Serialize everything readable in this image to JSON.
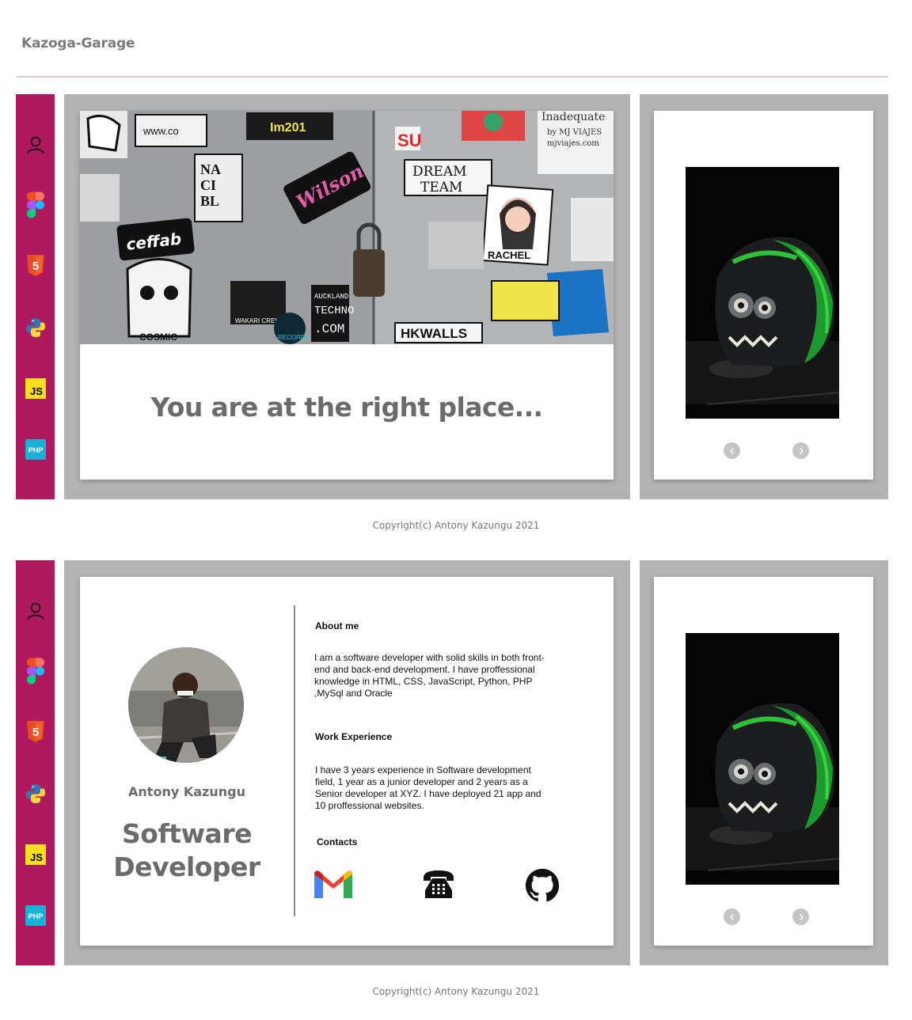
{
  "brand": {
    "title": "Kazoga-Garage"
  },
  "sidebar": {
    "items": [
      {
        "icon": "user-icon"
      },
      {
        "icon": "figma-icon"
      },
      {
        "icon": "html5-icon",
        "text": "5"
      },
      {
        "icon": "python-icon"
      },
      {
        "icon": "javascript-icon",
        "text": "JS"
      },
      {
        "icon": "php-icon",
        "text": "PHP"
      }
    ]
  },
  "hero": {
    "tagline": "You are at the right place...",
    "stickers": [
      "www.co",
      "Im201",
      "Inadequate",
      "by MJ VIAJES",
      "mjviajes.com",
      "SU",
      "NA",
      "CI",
      "BL",
      "DREAM",
      "TEAM",
      "Wilson",
      "ceffab",
      "RACHEL",
      "AUCKLAND",
      "TECHNO",
      ".COM",
      "HKWALLS",
      "COSMIC",
      "WAKARI CREW",
      "RECORDS"
    ]
  },
  "profile": {
    "name": "Antony Kazungu",
    "role_line1": "Software",
    "role_line2": "Developer",
    "about_title": "About me",
    "about_text": "I am a software developer with solid skills in both front-end and back-end development. I have proffessional knowledge in HTML, CSS, JavaScript, Python, PHP ,MySql and Oracle",
    "work_title": "Work Experience",
    "work_text": "I have 3 years experience in Software development field, 1 year as a junior developer and 2 years as a Senior developer at XYZ. I have deployed 21 app and 10 proffessional websites.",
    "contacts_title": "Contacts",
    "contacts": [
      "gmail-icon",
      "telephone-icon",
      "github-icon"
    ]
  },
  "carousel": {
    "prev": "prev-arrow-icon",
    "next": "next-arrow-icon"
  },
  "footer": {
    "copyright": "Copyright(c) Antony Kazungu 2021"
  },
  "colors": {
    "sidebar": "#b0195e",
    "card_bg": "#b3b3b3",
    "text_muted": "#6b6b6b"
  }
}
